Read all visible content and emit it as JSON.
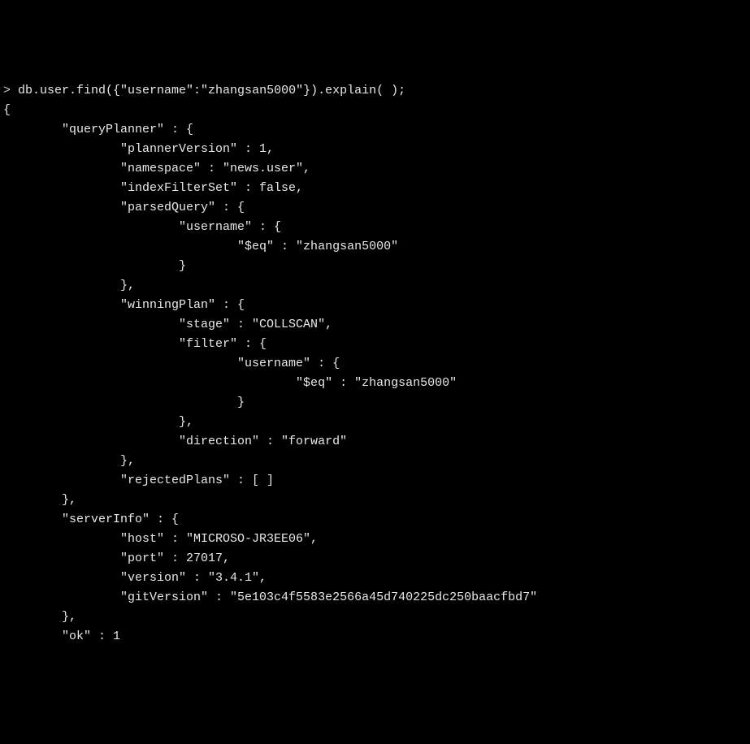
{
  "command": "db.user.find({\"username\":\"zhangsan5000\"}).explain( );",
  "output": {
    "open": "{",
    "queryPlanner_key": "        \"queryPlanner\" : {",
    "plannerVersion": "                \"plannerVersion\" : 1,",
    "namespace": "                \"namespace\" : \"news.user\",",
    "indexFilterSet": "                \"indexFilterSet\" : false,",
    "parsedQuery_open": "                \"parsedQuery\" : {",
    "parsedQuery_username_open": "                        \"username\" : {",
    "parsedQuery_eq": "                                \"$eq\" : \"zhangsan5000\"",
    "parsedQuery_username_close": "                        }",
    "parsedQuery_close": "                },",
    "winningPlan_open": "                \"winningPlan\" : {",
    "winningPlan_stage": "                        \"stage\" : \"COLLSCAN\",",
    "winningPlan_filter_open": "                        \"filter\" : {",
    "winningPlan_filter_username_open": "                                \"username\" : {",
    "winningPlan_filter_eq": "                                        \"$eq\" : \"zhangsan5000\"",
    "winningPlan_filter_username_close": "                                }",
    "winningPlan_filter_close": "                        },",
    "winningPlan_direction": "                        \"direction\" : \"forward\"",
    "winningPlan_close": "                },",
    "rejectedPlans": "                \"rejectedPlans\" : [ ]",
    "queryPlanner_close": "        },",
    "serverInfo_open": "        \"serverInfo\" : {",
    "serverInfo_host": "                \"host\" : \"MICROSO-JR3EE06\",",
    "serverInfo_port": "                \"port\" : 27017,",
    "serverInfo_version": "                \"version\" : \"3.4.1\",",
    "serverInfo_gitVersion": "                \"gitVersion\" : \"5e103c4f5583e2566a45d740225dc250baacfbd7\"",
    "serverInfo_close": "        },",
    "ok": "        \"ok\" : 1"
  },
  "prompt_char": "> "
}
